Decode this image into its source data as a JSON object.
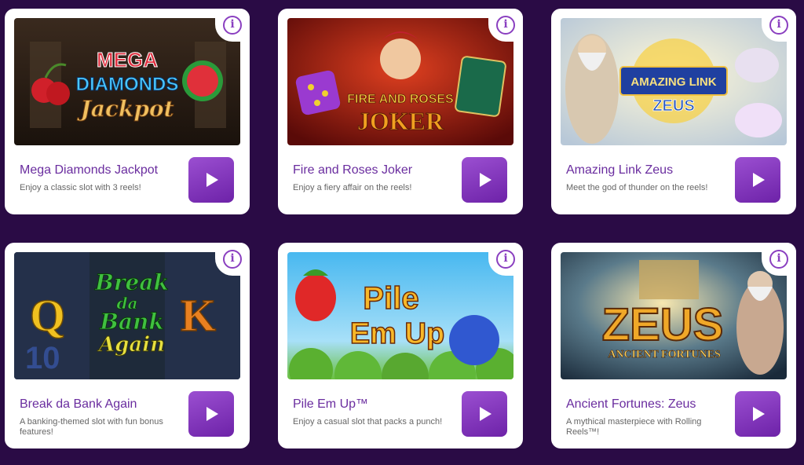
{
  "games": [
    {
      "title": "Mega Diamonds Jackpot",
      "description": "Enjoy a classic slot with 3 reels!",
      "art_text": [
        "MEGA",
        "DIAMONDS",
        "Jackpot"
      ],
      "play_icon": "play-icon",
      "info_icon": "info-icon"
    },
    {
      "title": "Fire and Roses Joker",
      "description": "Enjoy a fiery affair on the reels!",
      "art_text": [
        "FIRE AND ROSES",
        "JOKER"
      ],
      "play_icon": "play-icon",
      "info_icon": "info-icon"
    },
    {
      "title": "Amazing Link Zeus",
      "description": "Meet the god of thunder on the reels!",
      "art_text": [
        "AMAZING LINK",
        "ZEUS"
      ],
      "play_icon": "play-icon",
      "info_icon": "info-icon"
    },
    {
      "title": "Break da Bank Again",
      "description": "A banking-themed slot with fun bonus features!",
      "art_text": [
        "Break",
        "da",
        "Bank",
        "Again"
      ],
      "play_icon": "play-icon",
      "info_icon": "info-icon"
    },
    {
      "title": "Pile Em Up™",
      "description": "Enjoy a casual slot that packs a punch!",
      "art_text": [
        "Pile",
        "Em Up"
      ],
      "play_icon": "play-icon",
      "info_icon": "info-icon"
    },
    {
      "title": "Ancient Fortunes: Zeus",
      "description": "A mythical masterpiece with Rolling Reels™!",
      "art_text": [
        "ZEUS",
        "ANCIENT FORTUNES"
      ],
      "play_icon": "play-icon",
      "info_icon": "info-icon"
    }
  ],
  "info_symbol": "i",
  "colors": {
    "background": "#2a0b45",
    "accent": "#8a3fc0",
    "title": "#6a2d9f"
  }
}
